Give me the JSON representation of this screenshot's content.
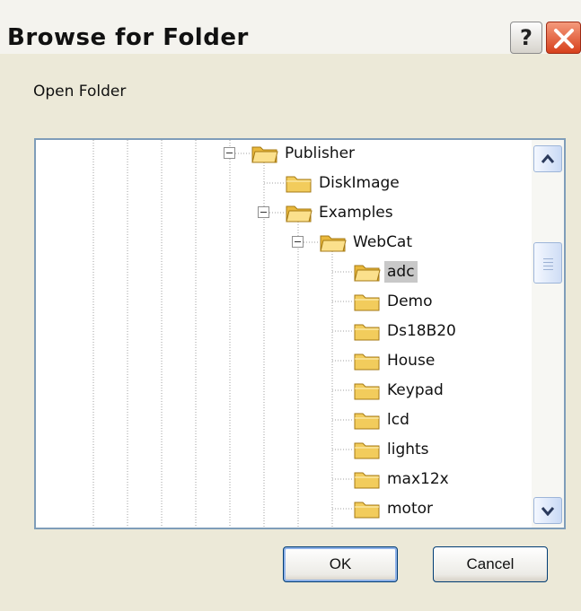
{
  "window": {
    "title": "Browse for Folder",
    "help_label": "?",
    "close_icon": "close-x-icon"
  },
  "prompt": "Open Folder",
  "tree": {
    "items": [
      {
        "label": "Publisher",
        "expanded": true
      },
      {
        "label": "DiskImage"
      },
      {
        "label": "Examples",
        "expanded": true
      },
      {
        "label": "WebCat",
        "expanded": true
      },
      {
        "label": "adc",
        "selected": true
      },
      {
        "label": "Demo"
      },
      {
        "label": "Ds18B20"
      },
      {
        "label": "House"
      },
      {
        "label": "Keypad"
      },
      {
        "label": "lcd"
      },
      {
        "label": "lights"
      },
      {
        "label": "max12x"
      },
      {
        "label": "motor"
      }
    ]
  },
  "buttons": {
    "ok": "OK",
    "cancel": "Cancel"
  },
  "colors": {
    "dialog_bg": "#ece9d8",
    "tree_border": "#7f9db9",
    "selection": "#c8c8c8",
    "close_button": "#d7401c",
    "folder": "#f2cc5c"
  }
}
